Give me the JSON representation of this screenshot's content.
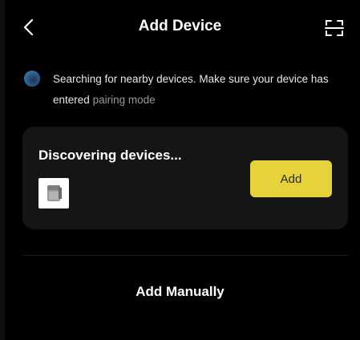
{
  "header": {
    "back_icon": "chevron-left-icon",
    "title": "Add Device",
    "scan_icon": "scan-icon"
  },
  "status": {
    "icon": "searching-spinner-icon",
    "text_main": "Searching for nearby devices. Make sure your device has entered",
    "pairing_link": "pairing mode"
  },
  "discovery_card": {
    "title": "Discovering devices...",
    "device_icon": "device-thumbnail-icon",
    "add_label": "Add"
  },
  "manual": {
    "label": "Add Manually"
  },
  "colors": {
    "background": "#000000",
    "card": "#151515",
    "accent": "#e6d23a",
    "link": "#9a9a9a"
  }
}
